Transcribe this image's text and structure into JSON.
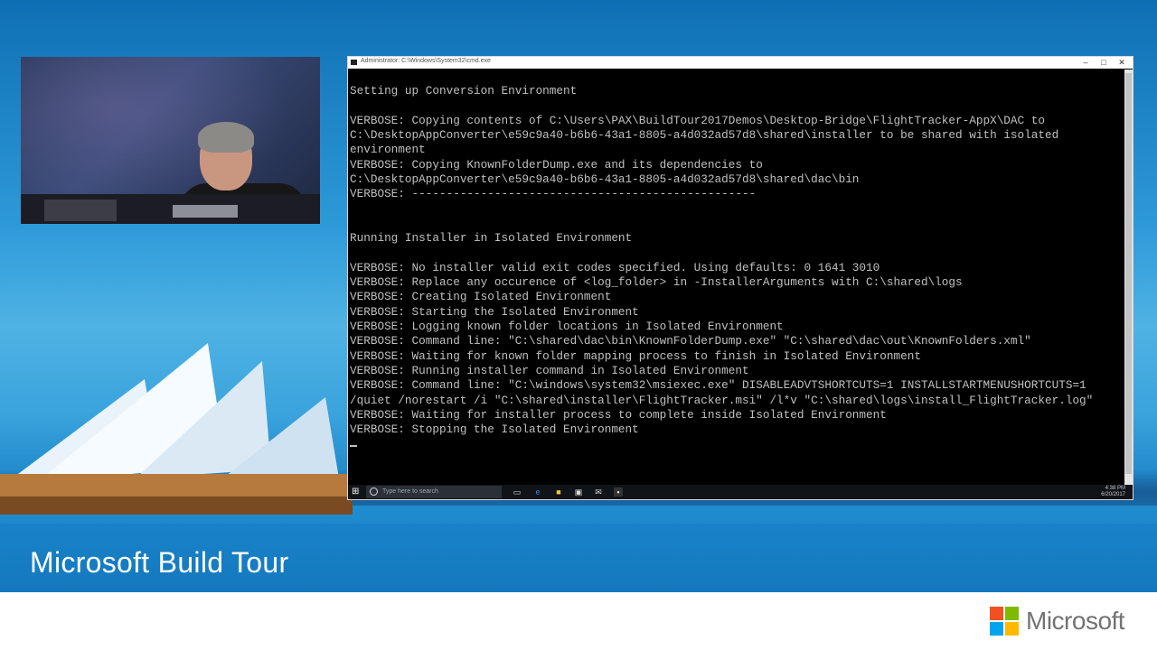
{
  "slide": {
    "event_title": "Microsoft Build Tour",
    "brand_wordmark": "Microsoft",
    "brand_colors": [
      "#f25022",
      "#7fba00",
      "#00a4ef",
      "#ffb900"
    ],
    "accent_color": "#1a8fd0"
  },
  "console": {
    "window_title": "Administrator: C:\\Windows\\System32\\cmd.exe",
    "controls": {
      "minimize": "–",
      "maximize": "□",
      "close": "✕"
    },
    "lines": [
      "",
      "Setting up Conversion Environment",
      "",
      "VERBOSE: Copying contents of C:\\Users\\PAX\\BuildTour2017Demos\\Desktop-Bridge\\FlightTracker-AppX\\DAC to",
      "C:\\DesktopAppConverter\\e59c9a40-b6b6-43a1-8805-a4d032ad57d8\\shared\\installer to be shared with isolated",
      "environment",
      "VERBOSE: Copying KnownFolderDump.exe and its dependencies to",
      "C:\\DesktopAppConverter\\e59c9a40-b6b6-43a1-8805-a4d032ad57d8\\shared\\dac\\bin",
      "VERBOSE: --------------------------------------------------",
      "",
      "",
      "Running Installer in Isolated Environment",
      "",
      "VERBOSE: No installer valid exit codes specified. Using defaults: 0 1641 3010",
      "VERBOSE: Replace any occurence of <log_folder> in -InstallerArguments with C:\\shared\\logs",
      "VERBOSE: Creating Isolated Environment",
      "VERBOSE: Starting the Isolated Environment",
      "VERBOSE: Logging known folder locations in Isolated Environment",
      "VERBOSE: Command line: \"C:\\shared\\dac\\bin\\KnownFolderDump.exe\" \"C:\\shared\\dac\\out\\KnownFolders.xml\"",
      "VERBOSE: Waiting for known folder mapping process to finish in Isolated Environment",
      "VERBOSE: Running installer command in Isolated Environment",
      "VERBOSE: Command line: \"C:\\windows\\system32\\msiexec.exe\" DISABLEADVTSHORTCUTS=1 INSTALLSTARTMENUSHORTCUTS=1",
      "/quiet /norestart /i \"C:\\shared\\installer\\FlightTracker.msi\" /l*v \"C:\\shared\\logs\\install_FlightTracker.log\"",
      "VERBOSE: Waiting for installer process to complete inside Isolated Environment",
      "VERBOSE: Stopping the Isolated Environment",
      ""
    ]
  },
  "taskbar": {
    "search_placeholder": "Type here to search",
    "start_glyph": "⊞",
    "tray_time": "4:38 PM",
    "tray_date": "6/20/2017"
  }
}
